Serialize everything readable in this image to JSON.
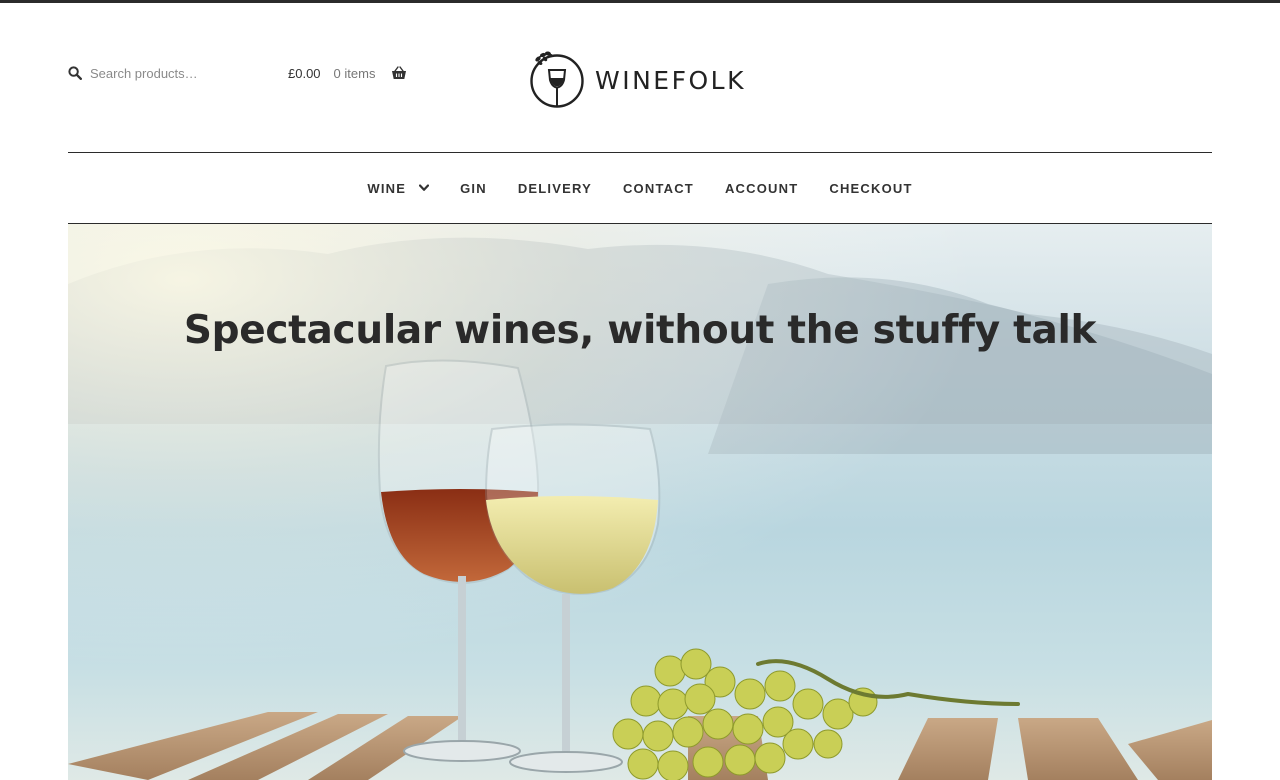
{
  "header": {
    "search": {
      "placeholder": "Search products…",
      "icon": "search-icon"
    },
    "cart": {
      "amount": "£0.00",
      "items": "0 items",
      "icon": "basket-icon"
    },
    "logo": {
      "brand": "WINEFOLK"
    }
  },
  "nav": {
    "items": [
      {
        "label": "WINE",
        "has_dropdown": true
      },
      {
        "label": "GIN"
      },
      {
        "label": "DELIVERY"
      },
      {
        "label": "CONTACT"
      },
      {
        "label": "ACCOUNT"
      },
      {
        "label": "CHECKOUT"
      }
    ]
  },
  "hero": {
    "headline": "Spectacular wines, without the stuffy talk"
  },
  "colors": {
    "text": "#333333",
    "rule": "#2b2b2b",
    "sky": "#cfe1e8"
  }
}
